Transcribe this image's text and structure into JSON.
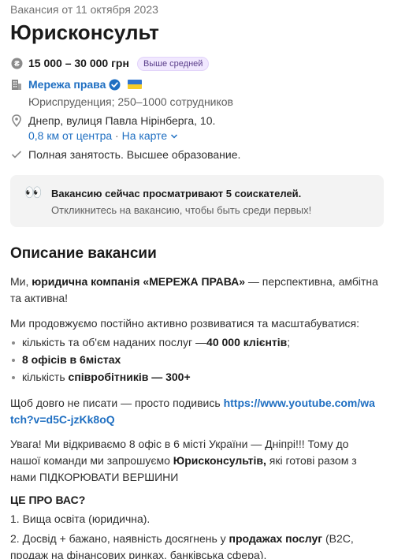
{
  "vacancy": {
    "posted": "Вакансия от 11 октября 2023",
    "title": "Юрисконсульт",
    "salary": "15 000 – 30 000 грн",
    "salary_badge": "Выше средней",
    "company": {
      "name": "Мережа права",
      "details": "Юриспруденция; 250–1000 сотрудников"
    },
    "location": {
      "address": "Днепр, вулиця Павла Нірінберга, 10.",
      "distance": "0,8 км от центра",
      "separator": "·",
      "map_link": "На карте"
    },
    "employment": "Полная занятость. Высшее образование."
  },
  "notice": {
    "emoji": "👀",
    "headline": "Вакансию сейчас просматривают 5 соискателей.",
    "subline": "Откликнитесь на вакансию, чтобы быть среди первых!"
  },
  "description": {
    "heading": "Описание вакансии",
    "intro": {
      "t1": "Ми, ",
      "b1": "юридична компанія «МЕРЕЖА ПРАВА»",
      "t2": " — перспективна, амбітна та активна!"
    },
    "growth": "Ми продовжуємо постійно активно розвиватися та масштабуватися:",
    "bullets": {
      "b1_text": "кількість та об'єм наданих послуг —",
      "b1_bold": "40 000 клієнтів",
      "b1_end": ";",
      "b2_bold": "8 офісів в 6містах",
      "b3_text": "кількість ",
      "b3_bold": "співробітників — 300+"
    },
    "video": {
      "text": "Щоб довго не писати — просто подивись ",
      "url": "https://www.youtube.com/watch?v=d5C-jzKk8oQ"
    },
    "attention": {
      "t1": "Увага! Ми відкриваємо 8 офіс в 6 місті України — Дніпрі!!! Тому до нашої команди ми запрошуємо ",
      "b1": "Юрисконсультів,",
      "t2": " які готові разом з нами ПІДКОРЮВАТИ ВЕРШИНИ"
    },
    "about_heading": "ЦЕ ПРО ВАС?",
    "list": {
      "i1": "1. Вища освіта (юридична).",
      "i2_a": "2. Досвід + бажано, наявність досягнень у ",
      "i2_b": "продажах послуг",
      "i2_c": " (B2C, продаж на фінансових ринках, банківська сфера)."
    }
  }
}
